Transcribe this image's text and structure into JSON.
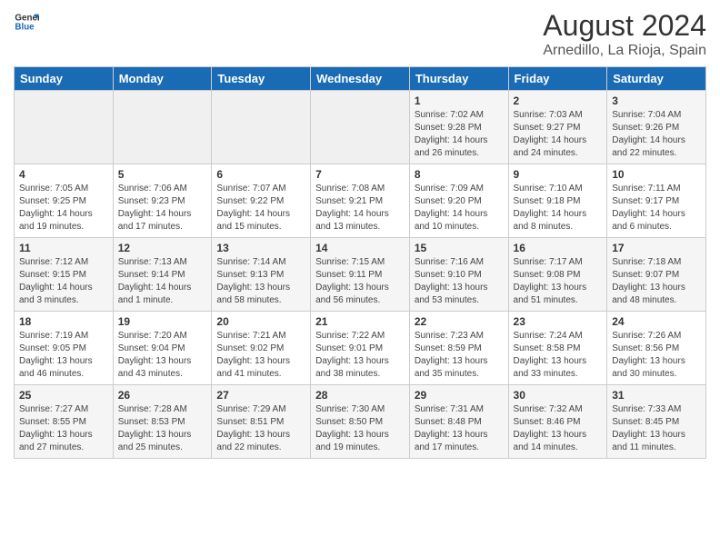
{
  "header": {
    "logo_line1": "General",
    "logo_line2": "Blue",
    "month": "August 2024",
    "location": "Arnedillo, La Rioja, Spain"
  },
  "weekdays": [
    "Sunday",
    "Monday",
    "Tuesday",
    "Wednesday",
    "Thursday",
    "Friday",
    "Saturday"
  ],
  "weeks": [
    [
      {
        "day": "",
        "info": ""
      },
      {
        "day": "",
        "info": ""
      },
      {
        "day": "",
        "info": ""
      },
      {
        "day": "",
        "info": ""
      },
      {
        "day": "1",
        "info": "Sunrise: 7:02 AM\nSunset: 9:28 PM\nDaylight: 14 hours\nand 26 minutes."
      },
      {
        "day": "2",
        "info": "Sunrise: 7:03 AM\nSunset: 9:27 PM\nDaylight: 14 hours\nand 24 minutes."
      },
      {
        "day": "3",
        "info": "Sunrise: 7:04 AM\nSunset: 9:26 PM\nDaylight: 14 hours\nand 22 minutes."
      }
    ],
    [
      {
        "day": "4",
        "info": "Sunrise: 7:05 AM\nSunset: 9:25 PM\nDaylight: 14 hours\nand 19 minutes."
      },
      {
        "day": "5",
        "info": "Sunrise: 7:06 AM\nSunset: 9:23 PM\nDaylight: 14 hours\nand 17 minutes."
      },
      {
        "day": "6",
        "info": "Sunrise: 7:07 AM\nSunset: 9:22 PM\nDaylight: 14 hours\nand 15 minutes."
      },
      {
        "day": "7",
        "info": "Sunrise: 7:08 AM\nSunset: 9:21 PM\nDaylight: 14 hours\nand 13 minutes."
      },
      {
        "day": "8",
        "info": "Sunrise: 7:09 AM\nSunset: 9:20 PM\nDaylight: 14 hours\nand 10 minutes."
      },
      {
        "day": "9",
        "info": "Sunrise: 7:10 AM\nSunset: 9:18 PM\nDaylight: 14 hours\nand 8 minutes."
      },
      {
        "day": "10",
        "info": "Sunrise: 7:11 AM\nSunset: 9:17 PM\nDaylight: 14 hours\nand 6 minutes."
      }
    ],
    [
      {
        "day": "11",
        "info": "Sunrise: 7:12 AM\nSunset: 9:15 PM\nDaylight: 14 hours\nand 3 minutes."
      },
      {
        "day": "12",
        "info": "Sunrise: 7:13 AM\nSunset: 9:14 PM\nDaylight: 14 hours\nand 1 minute."
      },
      {
        "day": "13",
        "info": "Sunrise: 7:14 AM\nSunset: 9:13 PM\nDaylight: 13 hours\nand 58 minutes."
      },
      {
        "day": "14",
        "info": "Sunrise: 7:15 AM\nSunset: 9:11 PM\nDaylight: 13 hours\nand 56 minutes."
      },
      {
        "day": "15",
        "info": "Sunrise: 7:16 AM\nSunset: 9:10 PM\nDaylight: 13 hours\nand 53 minutes."
      },
      {
        "day": "16",
        "info": "Sunrise: 7:17 AM\nSunset: 9:08 PM\nDaylight: 13 hours\nand 51 minutes."
      },
      {
        "day": "17",
        "info": "Sunrise: 7:18 AM\nSunset: 9:07 PM\nDaylight: 13 hours\nand 48 minutes."
      }
    ],
    [
      {
        "day": "18",
        "info": "Sunrise: 7:19 AM\nSunset: 9:05 PM\nDaylight: 13 hours\nand 46 minutes."
      },
      {
        "day": "19",
        "info": "Sunrise: 7:20 AM\nSunset: 9:04 PM\nDaylight: 13 hours\nand 43 minutes."
      },
      {
        "day": "20",
        "info": "Sunrise: 7:21 AM\nSunset: 9:02 PM\nDaylight: 13 hours\nand 41 minutes."
      },
      {
        "day": "21",
        "info": "Sunrise: 7:22 AM\nSunset: 9:01 PM\nDaylight: 13 hours\nand 38 minutes."
      },
      {
        "day": "22",
        "info": "Sunrise: 7:23 AM\nSunset: 8:59 PM\nDaylight: 13 hours\nand 35 minutes."
      },
      {
        "day": "23",
        "info": "Sunrise: 7:24 AM\nSunset: 8:58 PM\nDaylight: 13 hours\nand 33 minutes."
      },
      {
        "day": "24",
        "info": "Sunrise: 7:26 AM\nSunset: 8:56 PM\nDaylight: 13 hours\nand 30 minutes."
      }
    ],
    [
      {
        "day": "25",
        "info": "Sunrise: 7:27 AM\nSunset: 8:55 PM\nDaylight: 13 hours\nand 27 minutes."
      },
      {
        "day": "26",
        "info": "Sunrise: 7:28 AM\nSunset: 8:53 PM\nDaylight: 13 hours\nand 25 minutes."
      },
      {
        "day": "27",
        "info": "Sunrise: 7:29 AM\nSunset: 8:51 PM\nDaylight: 13 hours\nand 22 minutes."
      },
      {
        "day": "28",
        "info": "Sunrise: 7:30 AM\nSunset: 8:50 PM\nDaylight: 13 hours\nand 19 minutes."
      },
      {
        "day": "29",
        "info": "Sunrise: 7:31 AM\nSunset: 8:48 PM\nDaylight: 13 hours\nand 17 minutes."
      },
      {
        "day": "30",
        "info": "Sunrise: 7:32 AM\nSunset: 8:46 PM\nDaylight: 13 hours\nand 14 minutes."
      },
      {
        "day": "31",
        "info": "Sunrise: 7:33 AM\nSunset: 8:45 PM\nDaylight: 13 hours\nand 11 minutes."
      }
    ]
  ]
}
